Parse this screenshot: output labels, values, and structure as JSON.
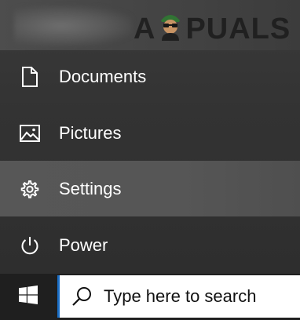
{
  "watermark": {
    "text_left": "A",
    "text_right": "PUALS"
  },
  "menu": {
    "items": [
      {
        "label": "Documents",
        "icon": "document-icon"
      },
      {
        "label": "Pictures",
        "icon": "pictures-icon"
      },
      {
        "label": "Settings",
        "icon": "gear-icon"
      },
      {
        "label": "Power",
        "icon": "power-icon"
      }
    ]
  },
  "taskbar": {
    "start_icon": "windows-logo-icon",
    "search": {
      "placeholder": "Type here to search",
      "icon": "search-icon"
    }
  },
  "colors": {
    "menu_bg": "#333333",
    "hover_bg": "#565656",
    "taskbar_bg": "#1f1f1f",
    "search_accent": "#1b6fc7"
  }
}
